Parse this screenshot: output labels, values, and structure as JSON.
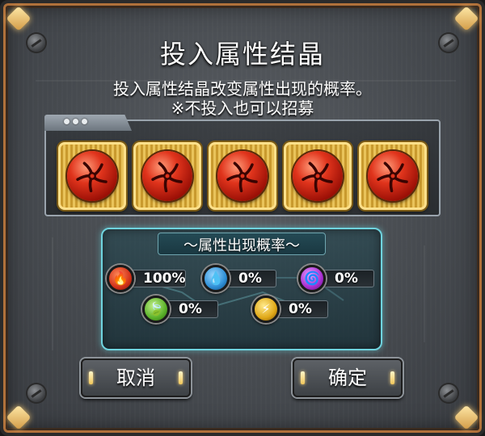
{
  "title": "投入属性结晶",
  "description_line1": "投入属性结晶改变属性出现的概率。",
  "description_line2": "※不投入也可以招募",
  "slots": [
    {
      "element": "fire-crystal"
    },
    {
      "element": "fire-crystal"
    },
    {
      "element": "fire-crystal"
    },
    {
      "element": "fire-crystal"
    },
    {
      "element": "fire-crystal"
    }
  ],
  "probability": {
    "title": "～属性出现概率～",
    "fire": "100%",
    "water": "0%",
    "dark": "0%",
    "wood": "0%",
    "thunder": "0%"
  },
  "buttons": {
    "cancel": "取消",
    "confirm": "确定"
  },
  "colors": {
    "accent_frame": "#b0713b",
    "probability_frame": "#6fd3de",
    "fire": "#e0341c",
    "water": "#3aa6e8",
    "dark": "#b03cd8",
    "wood": "#6cc23a",
    "thunder": "#e8b820"
  }
}
